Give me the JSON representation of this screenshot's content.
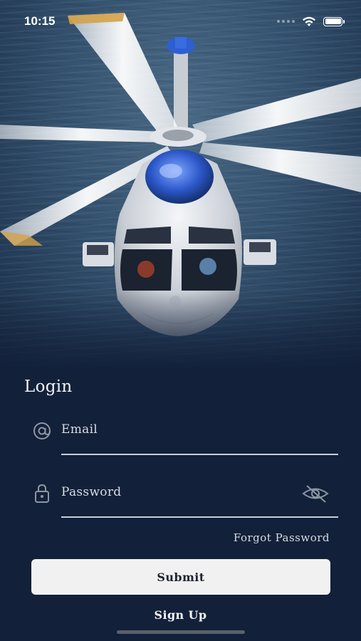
{
  "status_bar": {
    "time": "10:15"
  },
  "hero": {
    "image_subject": "helicopter over sea"
  },
  "login": {
    "title": "Login",
    "email": {
      "placeholder": "Email",
      "icon": "at-icon"
    },
    "password": {
      "placeholder": "Password",
      "icon": "lock-icon",
      "toggle_icon": "eye-slash-icon"
    },
    "forgot_label": "Forgot Password",
    "submit_label": "Submit",
    "signup_label": "Sign Up"
  },
  "colors": {
    "background": "#12203a",
    "button_bg": "#f1f1f1",
    "button_text": "#1c2433",
    "text_light": "#d8dce4"
  }
}
